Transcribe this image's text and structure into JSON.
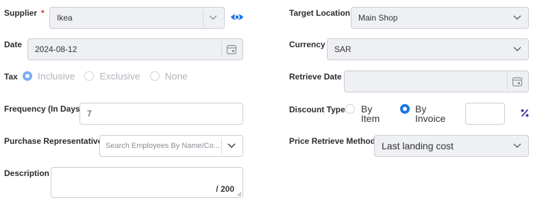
{
  "supplier": {
    "label": "Supplier",
    "required_mark": "*",
    "value": "Ikea"
  },
  "date": {
    "label": "Date",
    "value": "2024-08-12"
  },
  "tax": {
    "label": "Tax",
    "options": [
      "Inclusive",
      "Exclusive",
      "None"
    ],
    "selected": "Inclusive"
  },
  "frequency": {
    "label": "Frequency (In Days)",
    "value": "7"
  },
  "purchase_rep": {
    "label": "Purchase Representative",
    "placeholder": "Search Employees By Name/Co..."
  },
  "description": {
    "label": "Description",
    "counter": "/ 200"
  },
  "target_location": {
    "label": "Target Location",
    "value": "Main Shop"
  },
  "currency": {
    "label": "Currency",
    "value": "SAR"
  },
  "retrieve_date": {
    "label": "Retrieve Date",
    "value": ""
  },
  "discount_type": {
    "label": "Discount Type",
    "options": [
      [
        "By",
        "Item"
      ],
      [
        "By",
        "Invoice"
      ]
    ],
    "selected": "By Invoice",
    "value": ""
  },
  "price_retrieve": {
    "label": "Price Retrieve Method",
    "value": "Last landing cost"
  },
  "icons": {
    "eye": "eye-icon",
    "calendar": "calendar-icon",
    "chevron": "chevron-down-icon",
    "percent": "percent-icon"
  },
  "colors": {
    "accent": "#1a73e8",
    "percent": "#3b3b9e"
  }
}
